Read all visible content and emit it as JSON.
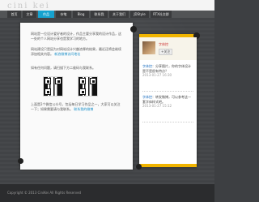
{
  "site": {
    "logo": "cini kei"
  },
  "nav": {
    "items": [
      "首页",
      "文章",
      "作品",
      "杂笔",
      "Blog",
      "联系我",
      "关于我们",
      "JDStyle",
      "RTX社交群"
    ],
    "active_index": 2
  },
  "content": {
    "para1": "网站是一位设计爱好者的设计，作品主要分享我的设计作品，这一处的个人网站分享也是我学习的地方。",
    "para2": "网站建设只是因为对网站设计兴趣浓厚的结果，最近还将会继续添加相关内容。",
    "link1": "新浪微博访问地址",
    "para3": "如有任何问题，请扫描下方二维码与我联系。",
    "para4": "上面是2个微信公众号，包括每日学习作品之一，大家可以关注一下；如果需要请与我联系。",
    "link2": "联系我的微博"
  },
  "weibo": {
    "name": "字体控",
    "follow_label": "+关注",
    "posts": [
      {
        "user": "字体控",
        "text": "分享图片，你的字体设计是不是很有特点？",
        "time": "2013-01-27 16:30"
      },
      {
        "user": "字体控",
        "text": "转发微博，可以参考这一套字体样式吧。",
        "time": "2013-01-27 15:12"
      }
    ]
  },
  "footer": {
    "copyright": "Copyright © 2013 CiniKei All Rights Reserved"
  },
  "colors": {
    "accent": "#16a2cf",
    "weibo_border": "#f0b400",
    "background": "#3d3f42"
  }
}
